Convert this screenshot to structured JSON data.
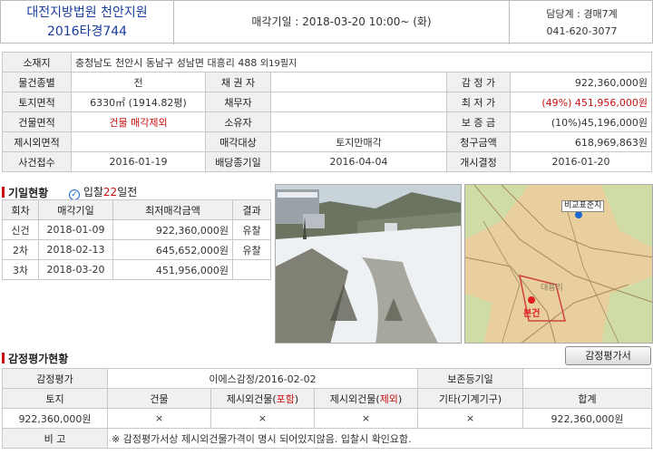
{
  "header": {
    "court_name": "대전지방법원 천안지원",
    "case_number": "2016타경744",
    "sale_label": "매각기일 : 2018-03-20    10:00~ (화)",
    "dept_label": "담당계 : 경매7계",
    "dept_phone": "041-620-3077"
  },
  "info": {
    "address_label": "소재지",
    "address": "충청남도 천안시 동남구 성남면 대흥리 488",
    "address_extra": "외19필지",
    "rows": [
      {
        "l1": "물건종별",
        "v1": "전",
        "l2": "채 권 자",
        "v2": "",
        "l3": "감 정 가",
        "v3": "922,360,000원"
      },
      {
        "l1": "토지면적",
        "v1": "6330㎡ (1914.82평)",
        "l2": "채무자",
        "v2": "",
        "l3": "최 저 가",
        "v3": "(49%) 451,956,000원"
      },
      {
        "l1": "건물면적",
        "v1": "건물 매각제외",
        "l2": "소유자",
        "v2": "",
        "l3": "보 증 금",
        "v3": "(10%)45,196,000원"
      },
      {
        "l1": "제시외면적",
        "v1": "",
        "l2": "매각대상",
        "v2": "토지만매각",
        "l3": "청구금액",
        "v3": "618,969,863원"
      },
      {
        "l1": "사건접수",
        "v1": "2016-01-19",
        "l2": "배당종기일",
        "v2": "2016-04-04",
        "l3": "개시결정",
        "v3": "2016-01-20"
      }
    ]
  },
  "history": {
    "title": "기일현황",
    "badge_prefix": "입찰",
    "badge_days": "22",
    "badge_suffix": "일전",
    "columns": [
      "회차",
      "매각기일",
      "최저매각금액",
      "결과"
    ],
    "rows": [
      {
        "round": "신건",
        "date": "2018-01-09",
        "price": "922,360,000원",
        "result": "유찰"
      },
      {
        "round": "2차",
        "date": "2018-02-13",
        "price": "645,652,000원",
        "result": "유찰"
      },
      {
        "round": "3차",
        "date": "2018-03-20",
        "price": "451,956,000원",
        "result": ""
      }
    ]
  },
  "map": {
    "label_top": "비교표준지",
    "label_main": "본건",
    "label_place": "대흥리"
  },
  "appraisal": {
    "title": "감정평가현황",
    "button": "감정평가서",
    "r1": {
      "l1": "감정평가",
      "v1": "이에스감정/2016-02-02",
      "l2": "보존등기일",
      "v2": ""
    },
    "cols": {
      "land": "토지",
      "building": "건물",
      "extra_in_a": "제시외건물(",
      "extra_in_b": "포함",
      "extra_in_c": ")",
      "extra_ex_a": "제시외건물(",
      "extra_ex_b": "제외",
      "extra_ex_c": ")",
      "etc": "기타(기계기구)",
      "total": "합계"
    },
    "vals": {
      "land": "922,360,000원",
      "building": "×",
      "extra_in": "×",
      "extra_ex": "×",
      "etc": "×",
      "total": "922,360,000원"
    },
    "note_label": "비 고",
    "note": "※ 감정평가서상 제시외건물가격이 명시 되어있지않음. 입찰시 확인요함."
  },
  "colors": {
    "accent": "#1a3fa0",
    "alert": "#c81010"
  }
}
